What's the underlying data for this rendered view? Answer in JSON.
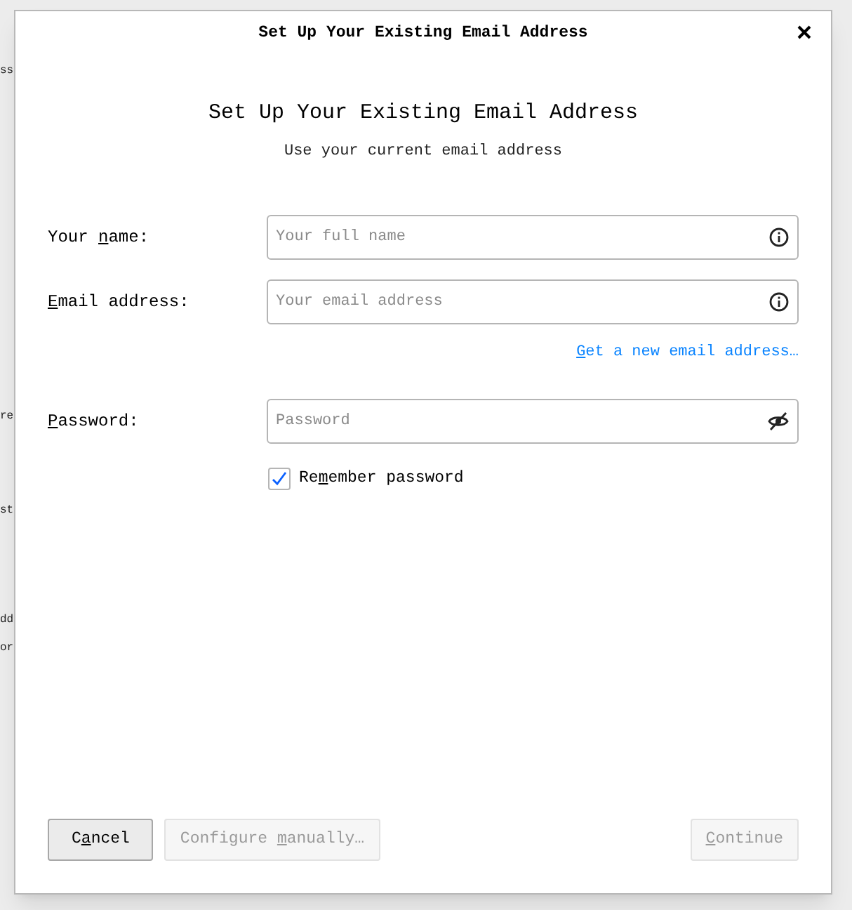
{
  "background_fragments": [
    {
      "text": "ss",
      "kind": "plain"
    },
    {
      "text": "re",
      "kind": "plain"
    },
    {
      "text": "st",
      "kind": "plain"
    },
    {
      "text": "dd",
      "kind": "plain"
    },
    {
      "text": "or",
      "kind": "plain"
    }
  ],
  "window": {
    "title": "Set Up Your Existing Email Address"
  },
  "heading": "Set Up Your Existing Email Address",
  "subheading": "Use your current email address",
  "fields": [
    {
      "kind": "info",
      "label_before": "Your ",
      "accesskey": "n",
      "label_after": "ame:",
      "placeholder": "Your full name"
    },
    {
      "kind": "info",
      "accesskey": "E",
      "label_after": "mail address:",
      "placeholder": "Your email address"
    },
    {
      "kind": "password",
      "accesskey": "P",
      "label_after": "assword:",
      "placeholder": "Password"
    }
  ],
  "link": {
    "accesskey": "G",
    "label_after": "et a new email address…"
  },
  "remember_password": {
    "label_before": "Re",
    "accesskey": "m",
    "label_after": "ember password",
    "checked": true
  },
  "buttons": [
    {
      "label_before": "C",
      "accesskey": "a",
      "label_after": "ncel",
      "disabled": false
    },
    {
      "label_before": "Configure ",
      "accesskey": "m",
      "label_after": "anually…",
      "disabled": true
    },
    {
      "accesskey": "C",
      "label_after": "ontinue",
      "disabled": true
    }
  ]
}
